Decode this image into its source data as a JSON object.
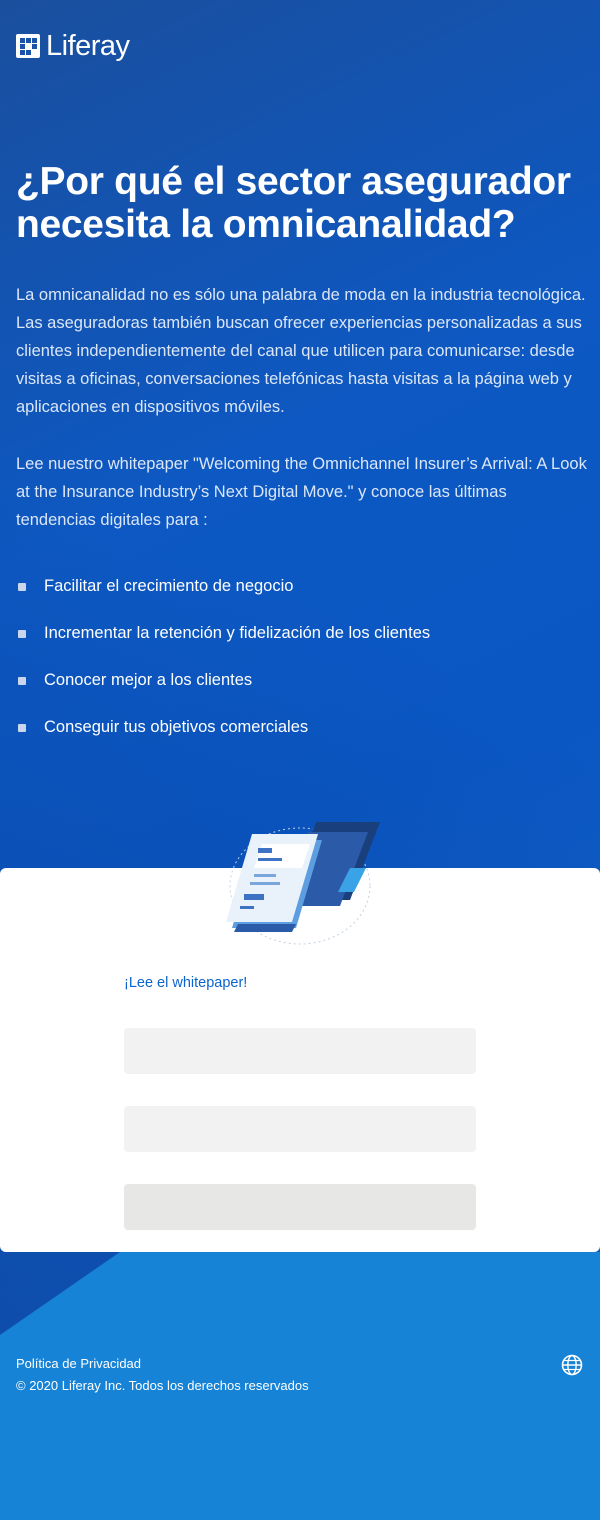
{
  "header": {
    "logo_text": "Liferay",
    "logo_icon": "liferay-logo-icon"
  },
  "hero": {
    "title": "¿Por qué el sector asegurador necesita la omnicanalidad?",
    "paragraph_1": "La omnicanalidad no es sólo una palabra de moda en la industria tecnológica. Las aseguradoras también buscan ofrecer experiencias personalizadas a sus clientes independientemente del canal que utilicen para comunicarse: desde visitas a oficinas, conversaciones telefónicas hasta visitas a la página web y aplicaciones en dispositivos móviles.",
    "paragraph_2": "Lee nuestro whitepaper \"Welcoming the Omnichannel Insurer’s Arrival: A Look at the Insurance Industry’s Next Digital Move.\" y conoce las últimas tendencias digitales para :",
    "bullets": [
      "Facilitar el crecimiento de negocio",
      "Incrementar la retención y fidelización de los clientes",
      "Conocer mejor a los clientes",
      "Conseguir tus objetivos comerciales"
    ]
  },
  "form": {
    "link_text": "¡Lee el whitepaper!",
    "field_1_placeholder": "",
    "field_2_placeholder": "",
    "submit_label": ""
  },
  "footer": {
    "privacy_link": "Política de Privacidad",
    "copyright": "© 2020 Liferay Inc. Todos los derechos reservados",
    "language_icon": "globe-icon"
  },
  "colors": {
    "hero_bg": "#0d58c2",
    "footer_bg": "#1683d6",
    "link": "#0b63ce",
    "input_bg": "#f2f2f2"
  }
}
